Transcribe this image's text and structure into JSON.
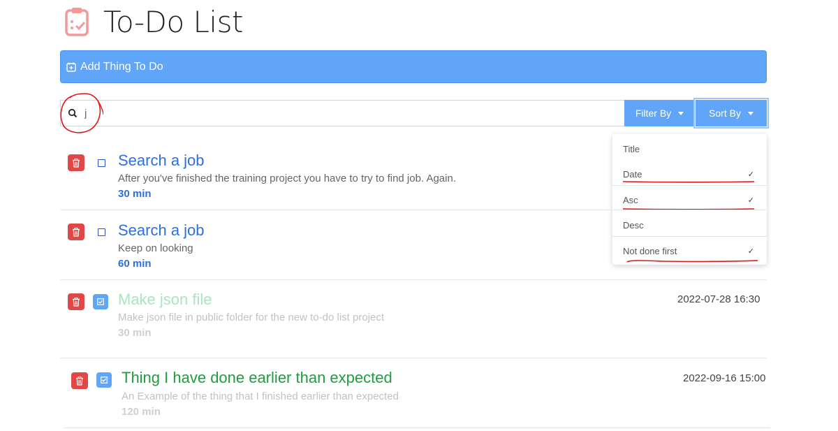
{
  "app": {
    "title": "To-Do List"
  },
  "add_bar": {
    "label": "Add Thing To Do"
  },
  "search": {
    "value": "j"
  },
  "toolbar": {
    "filter_label": "Filter By",
    "sort_label": "Sort By"
  },
  "sort_menu": {
    "items": [
      {
        "label": "Title",
        "checked": false
      },
      {
        "label": "Date",
        "checked": true
      },
      {
        "label": "Asc",
        "checked": true
      },
      {
        "label": "Desc",
        "checked": false
      },
      {
        "label": "Not done first",
        "checked": true
      }
    ],
    "check_glyph": "✓"
  },
  "todos": [
    {
      "title": "Search a job",
      "description": "After you've finished the training project you have to try to find job. Again.",
      "duration": "30 min",
      "done": false,
      "date": ""
    },
    {
      "title": "Search a job",
      "description": "Keep on looking",
      "duration": "60 min",
      "done": false,
      "date": ""
    },
    {
      "title": "Make json file",
      "description": "Make json file in public folder for the new to-do list project",
      "duration": "30 min",
      "done": true,
      "date": "2022-07-28 16:30"
    },
    {
      "title": "Thing I have done earlier than expected",
      "description": "An Example of the thing that I finished earlier than expected",
      "duration": "120 min",
      "done": true,
      "date": "2022-09-16 15:00"
    }
  ],
  "colors": {
    "accent": "#60a5f7",
    "danger": "#e04848",
    "todo_title": "#2f6fdc",
    "done_title_faded": "#a8e6c0",
    "done_title": "#1e9e3e",
    "annotation": "#e01818"
  }
}
